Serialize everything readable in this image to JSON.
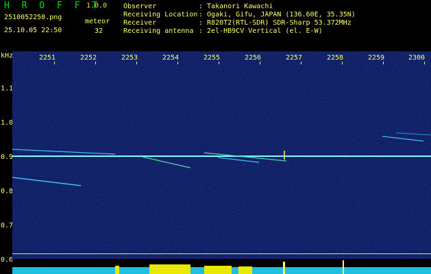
{
  "app": {
    "title": "H R O F F T",
    "version": "1.0.0"
  },
  "file": {
    "name": "2510052250.png",
    "datetime": "25.10.05 22:50"
  },
  "meteor": {
    "label": "meteor",
    "count": "32"
  },
  "info": [
    {
      "key": "Observer",
      "value": ": Takanori Kawachi"
    },
    {
      "key": "Receiving Location",
      "value": ": Ogaki, Gifu, JAPAN (136.60E, 35.35N)"
    },
    {
      "key": "Receiver",
      "value": ": R820T2(RTL-SDR) SDR-Sharp 53.372MHz"
    },
    {
      "key": "Receiving antenna",
      "value": ": 2el-HB9CV Vertical (el. E-W)"
    }
  ],
  "axis": {
    "y_unit": "kHz",
    "y_ticks": [
      "1.1",
      "1.0",
      "0.9",
      "0.8",
      "0.7",
      "0.6"
    ],
    "x_ticks": [
      "2251",
      "2252",
      "2253",
      "2254",
      "2255",
      "2256",
      "2257",
      "2258",
      "2259",
      "2300"
    ]
  },
  "colors": {
    "header_text": "#ffff66",
    "title": "#00e000",
    "background": "#06104a",
    "carrier": "#7fffff"
  }
}
